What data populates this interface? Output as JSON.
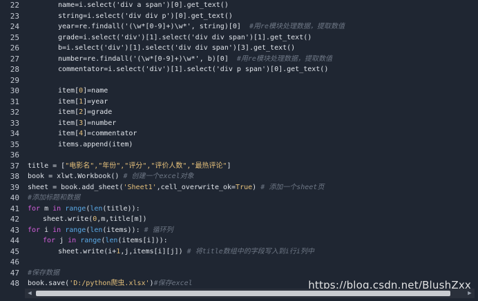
{
  "lines": [
    {
      "n": "22",
      "indent": 2,
      "tokens": [
        [
          "op",
          "name=i.select('div a span')[0].get_text()"
        ]
      ]
    },
    {
      "n": "23",
      "indent": 2,
      "tokens": [
        [
          "op",
          "string=i.select('div div p')[0].get_text()"
        ]
      ]
    },
    {
      "n": "24",
      "indent": 2,
      "tokens": [
        [
          "op",
          "year=re.findall('(\\w*[0-9]+)\\w*', string)[0]  "
        ],
        [
          "cmt",
          "#用re模块处理数据，提取数值"
        ]
      ]
    },
    {
      "n": "25",
      "indent": 2,
      "tokens": [
        [
          "op",
          "grade=i.select('div')[1].select('div div span')[1].get_text()"
        ]
      ]
    },
    {
      "n": "26",
      "indent": 2,
      "tokens": [
        [
          "op",
          "b=i.select('div')[1].select('div div span')[3].get_text()"
        ]
      ]
    },
    {
      "n": "27",
      "indent": 2,
      "tokens": [
        [
          "op",
          "number=re.findall('(\\w*[0-9]+)\\w*', b)[0]  "
        ],
        [
          "cmt",
          "#用re模块处理数据，提取数值"
        ]
      ]
    },
    {
      "n": "28",
      "indent": 2,
      "tokens": [
        [
          "op",
          "commentator=i.select('div')[1].select('div p span')[0].get_text()"
        ]
      ]
    },
    {
      "n": "29",
      "indent": 0,
      "tokens": []
    },
    {
      "n": "30",
      "indent": 2,
      "tokens": [
        [
          "op",
          "item["
        ],
        [
          "num",
          "0"
        ],
        [
          "op",
          "]=name"
        ]
      ]
    },
    {
      "n": "31",
      "indent": 2,
      "tokens": [
        [
          "op",
          "item["
        ],
        [
          "num",
          "1"
        ],
        [
          "op",
          "]=year"
        ]
      ]
    },
    {
      "n": "32",
      "indent": 2,
      "tokens": [
        [
          "op",
          "item["
        ],
        [
          "num",
          "2"
        ],
        [
          "op",
          "]=grade"
        ]
      ]
    },
    {
      "n": "33",
      "indent": 2,
      "tokens": [
        [
          "op",
          "item["
        ],
        [
          "num",
          "3"
        ],
        [
          "op",
          "]=number"
        ]
      ]
    },
    {
      "n": "34",
      "indent": 2,
      "tokens": [
        [
          "op",
          "item["
        ],
        [
          "num",
          "4"
        ],
        [
          "op",
          "]=commentator"
        ]
      ]
    },
    {
      "n": "35",
      "indent": 2,
      "tokens": [
        [
          "op",
          "items.append(item)"
        ]
      ]
    },
    {
      "n": "36",
      "indent": 0,
      "tokens": []
    },
    {
      "n": "37",
      "indent": 0,
      "tokens": [
        [
          "op",
          "title = ["
        ],
        [
          "str",
          "\"电影名\",\"年份\",\"评分\",\"评价人数\",\"最热评论\""
        ],
        [
          "op",
          "]"
        ]
      ]
    },
    {
      "n": "38",
      "indent": 0,
      "tokens": [
        [
          "op",
          "book = xlwt.Workbook() "
        ],
        [
          "cmt",
          "# 创建一个excel对象"
        ]
      ]
    },
    {
      "n": "39",
      "indent": 0,
      "tokens": [
        [
          "op",
          "sheet = book.add_sheet("
        ],
        [
          "str",
          "'Sheet1'"
        ],
        [
          "op",
          ",cell_overwrite_ok="
        ],
        [
          "bool",
          "True"
        ],
        [
          "op",
          ") "
        ],
        [
          "cmt",
          "# 添加一个sheet页"
        ]
      ]
    },
    {
      "n": "40",
      "indent": 0,
      "tokens": [
        [
          "cmt",
          "#添加标题和数据"
        ]
      ]
    },
    {
      "n": "41",
      "indent": 0,
      "tokens": [
        [
          "kw",
          "for"
        ],
        [
          "op",
          " m "
        ],
        [
          "kw",
          "in"
        ],
        [
          "op",
          " "
        ],
        [
          "fn",
          "range"
        ],
        [
          "op",
          "("
        ],
        [
          "fn",
          "len"
        ],
        [
          "op",
          "(title)):"
        ]
      ]
    },
    {
      "n": "42",
      "indent": 1,
      "tokens": [
        [
          "op",
          "sheet.write("
        ],
        [
          "num",
          "0"
        ],
        [
          "op",
          ",m,title[m])"
        ]
      ]
    },
    {
      "n": "43",
      "indent": 0,
      "tokens": [
        [
          "kw",
          "for"
        ],
        [
          "op",
          " i "
        ],
        [
          "kw",
          "in"
        ],
        [
          "op",
          " "
        ],
        [
          "fn",
          "range"
        ],
        [
          "op",
          "("
        ],
        [
          "fn",
          "len"
        ],
        [
          "op",
          "(items)): "
        ],
        [
          "cmt",
          "# 循环列"
        ]
      ]
    },
    {
      "n": "44",
      "indent": 1,
      "tokens": [
        [
          "kw",
          "for"
        ],
        [
          "op",
          " j "
        ],
        [
          "kw",
          "in"
        ],
        [
          "op",
          " "
        ],
        [
          "fn",
          "range"
        ],
        [
          "op",
          "("
        ],
        [
          "fn",
          "len"
        ],
        [
          "op",
          "(items[i])):"
        ]
      ]
    },
    {
      "n": "45",
      "indent": 2,
      "tokens": [
        [
          "op",
          "sheet.write(i+"
        ],
        [
          "num",
          "1"
        ],
        [
          "op",
          ",j,items[i][j]) "
        ],
        [
          "cmt",
          "# 将title数组中的字段写入到i行i列中"
        ]
      ]
    },
    {
      "n": "46",
      "indent": 0,
      "tokens": []
    },
    {
      "n": "47",
      "indent": 0,
      "tokens": [
        [
          "cmt",
          "#保存数据"
        ]
      ]
    },
    {
      "n": "48",
      "indent": 0,
      "tokens": [
        [
          "op",
          "book.save("
        ],
        [
          "str",
          "'D:/python爬虫.xlsx'"
        ],
        [
          "op",
          ")"
        ],
        [
          "cmt",
          "#保存excel"
        ]
      ]
    }
  ],
  "watermark": "https://blog.csdn.net/BlushZxx",
  "scrollbar": {
    "left_arrow": "◀",
    "right_arrow": "▶"
  },
  "colors": {
    "background": "#1f2632",
    "keyword": "#d55fdc",
    "builtin": "#5aa9e6",
    "string": "#e5c07b",
    "comment": "#6e7785",
    "text": "#d7dbe2"
  }
}
